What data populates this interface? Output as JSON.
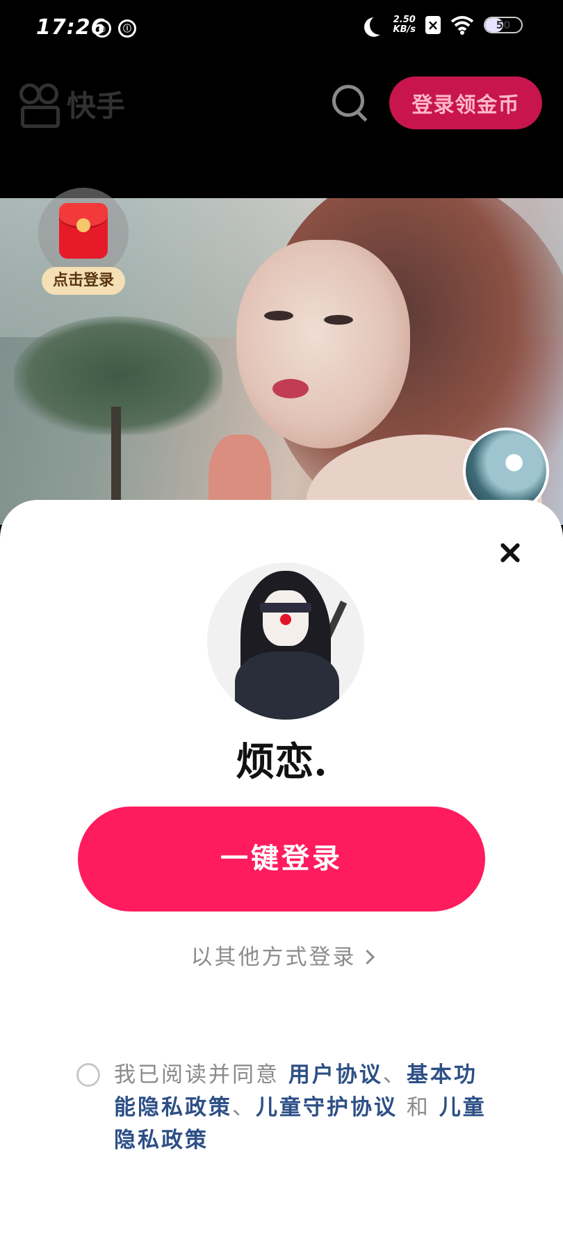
{
  "status_bar": {
    "time": "17:26",
    "icons": [
      "nfc-icon",
      "notification-icon",
      "moon-icon",
      "network-speed",
      "app-notification-icon",
      "wifi-icon",
      "battery-icon"
    ],
    "speed_value": "2.50",
    "speed_unit": "KB/s",
    "battery_level": "50",
    "battery_fraction": 0.5
  },
  "header": {
    "app_name": "快手",
    "login_coin_label": "登录领金币"
  },
  "video": {
    "redpack_label": "点击登录"
  },
  "login_sheet": {
    "username": "烦恋.",
    "onekey_label": "一键登录",
    "other_login_label": "以其他方式登录",
    "agreement_prefix": "我已阅读并同意",
    "agreement_links": [
      "用户协议",
      "基本功能隐私政策",
      "儿童守护协议",
      "儿童隐私政策"
    ],
    "separator": "、",
    "conjunction": "和"
  },
  "colors": {
    "brand_pink": "#fe1c5e",
    "coin_button": "#c8154e",
    "link_blue": "#2d4f86"
  }
}
